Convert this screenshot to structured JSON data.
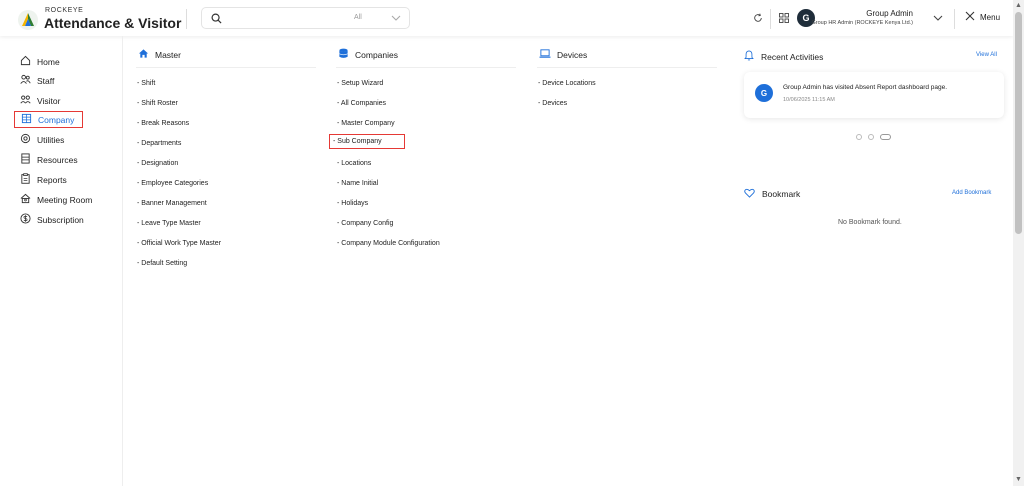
{
  "header": {
    "brand_small": "ROCKEYE",
    "brand_big": "Attendance & Visitor",
    "search_placeholder": "",
    "search_scope": "All",
    "user_initial": "G",
    "user_name": "Group Admin",
    "user_role": "Group HR Admin (ROCKEYE Kenya Ltd.)",
    "menu_label": "Menu"
  },
  "sidebar": {
    "items": [
      {
        "label": "Home",
        "icon": "home-icon"
      },
      {
        "label": "Staff",
        "icon": "users-icon"
      },
      {
        "label": "Visitor",
        "icon": "visitor-icon"
      },
      {
        "label": "Company",
        "icon": "building-icon"
      },
      {
        "label": "Utilities",
        "icon": "gear-icon"
      },
      {
        "label": "Resources",
        "icon": "resources-icon"
      },
      {
        "label": "Reports",
        "icon": "clipboard-icon"
      },
      {
        "label": "Meeting Room",
        "icon": "meeting-room-icon"
      },
      {
        "label": "Subscription",
        "icon": "currency-icon"
      }
    ],
    "active": "Company"
  },
  "columns": {
    "master": {
      "title": "Master",
      "links": [
        "- Shift",
        "- Shift Roster",
        "- Break Reasons",
        "- Departments",
        "- Designation",
        "- Employee Categories",
        "- Banner Management",
        "- Leave Type Master",
        "- Official Work Type Master",
        "- Default Setting"
      ]
    },
    "companies": {
      "title": "Companies",
      "links": [
        "- Setup Wizard",
        "- All Companies",
        "- Master Company",
        "- Sub Company",
        "- Locations",
        "- Name Initial",
        "- Holidays",
        "- Company Config",
        "- Company Module Configuration"
      ]
    },
    "devices": {
      "title": "Devices",
      "links": [
        "- Device Locations",
        "- Devices"
      ]
    }
  },
  "recent": {
    "title": "Recent Activities",
    "view_all": "View All",
    "activity": {
      "initial": "G",
      "text": "Group Admin has visited Absent Report dashboard page.",
      "time": "10/06/2025 11:15 AM"
    }
  },
  "bookmark": {
    "title": "Bookmark",
    "add_label": "Add Bookmark",
    "empty_text": "No Bookmark found."
  },
  "colors": {
    "accent": "#1e6fd9",
    "highlight": "#e53935",
    "avatar_dark": "#1f2d3a"
  }
}
